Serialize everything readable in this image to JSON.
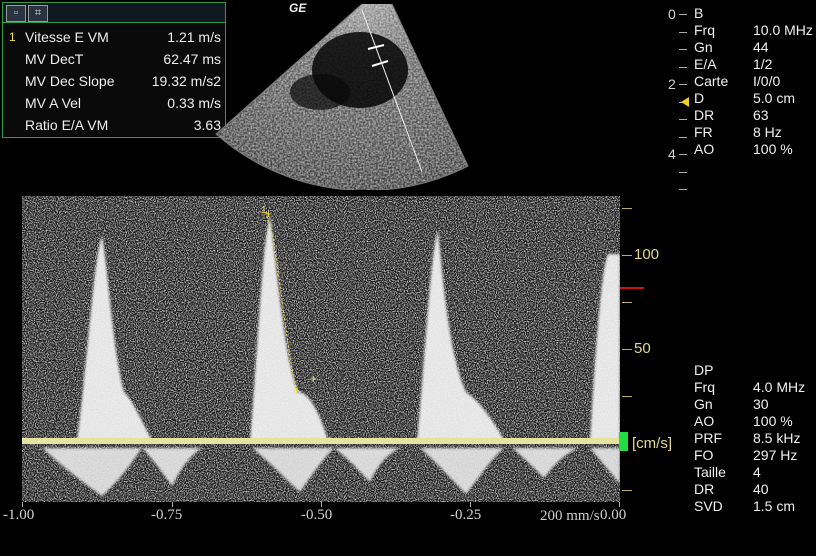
{
  "brand": "GE",
  "measurements": [
    {
      "index": "1",
      "label": "Vitesse E VM",
      "value": "1.21 m/s"
    },
    {
      "index": "",
      "label": "MV DecT",
      "value": "62.47 ms"
    },
    {
      "index": "",
      "label": "MV Dec Slope",
      "value": "19.32 m/s2"
    },
    {
      "index": "",
      "label": "MV A Vel",
      "value": "0.33 m/s"
    },
    {
      "index": "",
      "label": "Ratio E/A VM",
      "value": "3.63"
    }
  ],
  "depth_scale": [
    "0",
    "2",
    "4"
  ],
  "b_mode": {
    "title": "B",
    "params": [
      {
        "label": "Frq",
        "value": "10.0 MHz"
      },
      {
        "label": "Gn",
        "value": "44"
      },
      {
        "label": "E/A",
        "value": "1/2"
      },
      {
        "label": "Carte",
        "value": "I/0/0"
      },
      {
        "label": "D",
        "value": "5.0 cm"
      },
      {
        "label": "DR",
        "value": "63"
      },
      {
        "label": "FR",
        "value": "8 Hz"
      },
      {
        "label": "AO",
        "value": "100 %"
      }
    ]
  },
  "pw_mode": {
    "title": "DP",
    "params": [
      {
        "label": "Frq",
        "value": "4.0 MHz"
      },
      {
        "label": "Gn",
        "value": "30"
      },
      {
        "label": "AO",
        "value": "100 %"
      },
      {
        "label": "PRF",
        "value": "8.5 kHz"
      },
      {
        "label": "FO",
        "value": "297 Hz"
      },
      {
        "label": "Taille",
        "value": "4"
      },
      {
        "label": "DR",
        "value": "40"
      },
      {
        "label": "SVD",
        "value": "1.5 cm"
      }
    ]
  },
  "velocity_scale": {
    "ticks": [
      "100",
      "50"
    ],
    "unit": "[cm/s]"
  },
  "time_scale": {
    "labels": [
      "-1.00",
      "-0.75",
      "-0.50",
      "-0.25",
      "0.00"
    ],
    "speed": "200 mm/s"
  },
  "caliper_marker": "1",
  "colors": {
    "panel_border": "#2e9a4a",
    "scale_text": "#e0d890",
    "baseline": "#e6e2a0",
    "caliper": "#f0e050",
    "indicator_green": "#22dd44",
    "indicator_red": "#cc1111"
  }
}
